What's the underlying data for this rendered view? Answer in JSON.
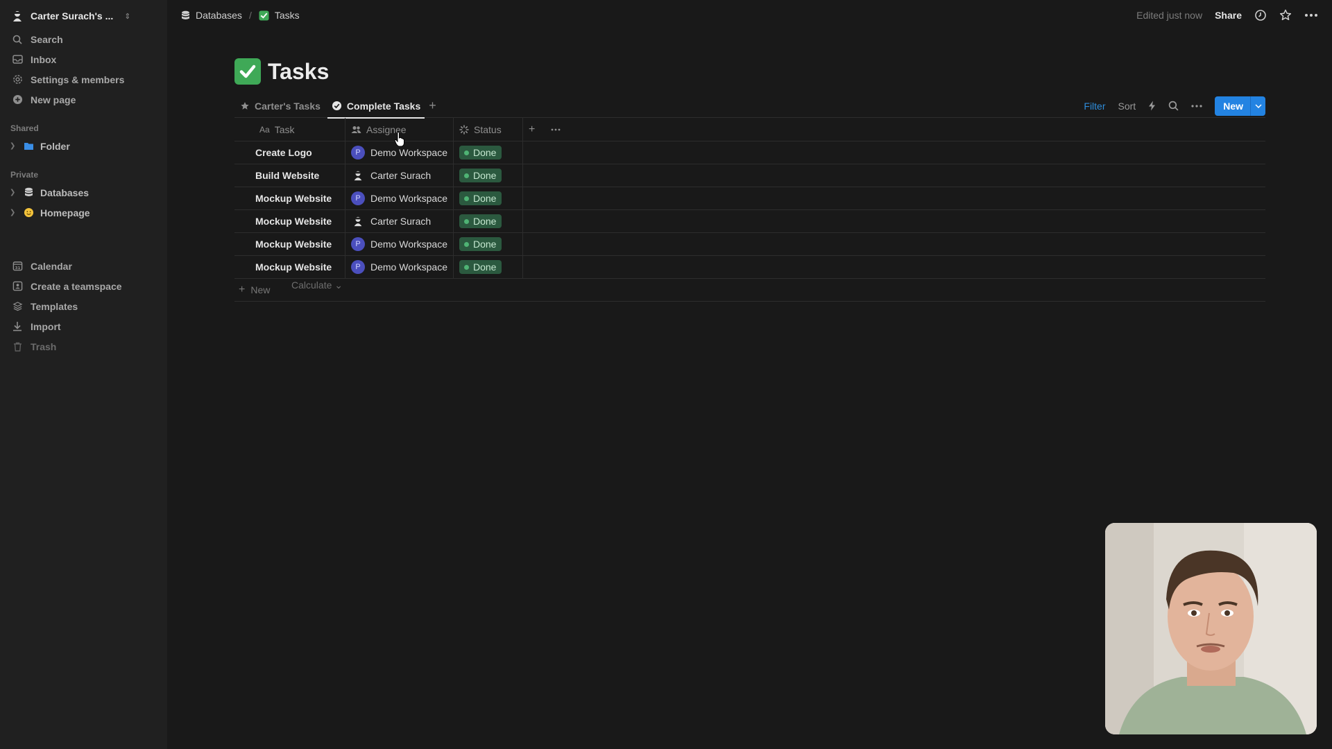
{
  "sidebar": {
    "workspace_name": "Carter Surach's ...",
    "items": [
      {
        "label": "Search",
        "icon": "search-icon"
      },
      {
        "label": "Inbox",
        "icon": "inbox-icon"
      },
      {
        "label": "Settings & members",
        "icon": "gear-icon"
      },
      {
        "label": "New page",
        "icon": "plus-circle-icon"
      }
    ],
    "shared_label": "Shared",
    "shared_items": [
      {
        "label": "Folder",
        "icon": "folder-icon"
      }
    ],
    "private_label": "Private",
    "private_items": [
      {
        "label": "Databases",
        "icon": "database-icon"
      },
      {
        "label": "Homepage",
        "icon": "smiley-icon"
      }
    ],
    "bottom_items": [
      {
        "label": "Calendar",
        "icon": "calendar-icon"
      },
      {
        "label": "Create a teamspace",
        "icon": "teamspace-icon"
      },
      {
        "label": "Templates",
        "icon": "templates-icon"
      },
      {
        "label": "Import",
        "icon": "download-icon"
      },
      {
        "label": "Trash",
        "icon": "trash-icon"
      }
    ]
  },
  "topbar": {
    "breadcrumb": [
      {
        "label": "Databases"
      },
      {
        "label": "Tasks"
      }
    ],
    "separator": "/",
    "edited": "Edited just now",
    "share": "Share"
  },
  "page": {
    "title": "Tasks",
    "views": [
      {
        "label": "Carter's Tasks",
        "active": false
      },
      {
        "label": "Complete Tasks",
        "active": true
      }
    ],
    "actions": {
      "filter": "Filter",
      "sort": "Sort",
      "new": "New"
    }
  },
  "table": {
    "columns": [
      {
        "label": "Task",
        "prefix": "Aa"
      },
      {
        "label": "Assignee"
      },
      {
        "label": "Status"
      }
    ],
    "rows": [
      {
        "task": "Create Logo",
        "assignee": "Demo Workspace",
        "assignee_initial": "P",
        "status": "Done"
      },
      {
        "task": "Build Website",
        "assignee": "Carter Surach",
        "assignee_initial": "",
        "status": "Done"
      },
      {
        "task": "Mockup Website",
        "assignee": "Demo Workspace",
        "assignee_initial": "P",
        "status": "Done"
      },
      {
        "task": "Mockup Website",
        "assignee": "Carter Surach",
        "assignee_initial": "",
        "status": "Done"
      },
      {
        "task": "Mockup Website",
        "assignee": "Demo Workspace",
        "assignee_initial": "P",
        "status": "Done"
      },
      {
        "task": "Mockup Website",
        "assignee": "Demo Workspace",
        "assignee_initial": "P",
        "status": "Done"
      }
    ],
    "new_row": "New",
    "calculate": "Calculate"
  },
  "colors": {
    "accent": "#2383e2",
    "done_badge": "#2b593f",
    "title_icon": "#3fa957",
    "workspace_avatar": "#4b4fbd"
  }
}
